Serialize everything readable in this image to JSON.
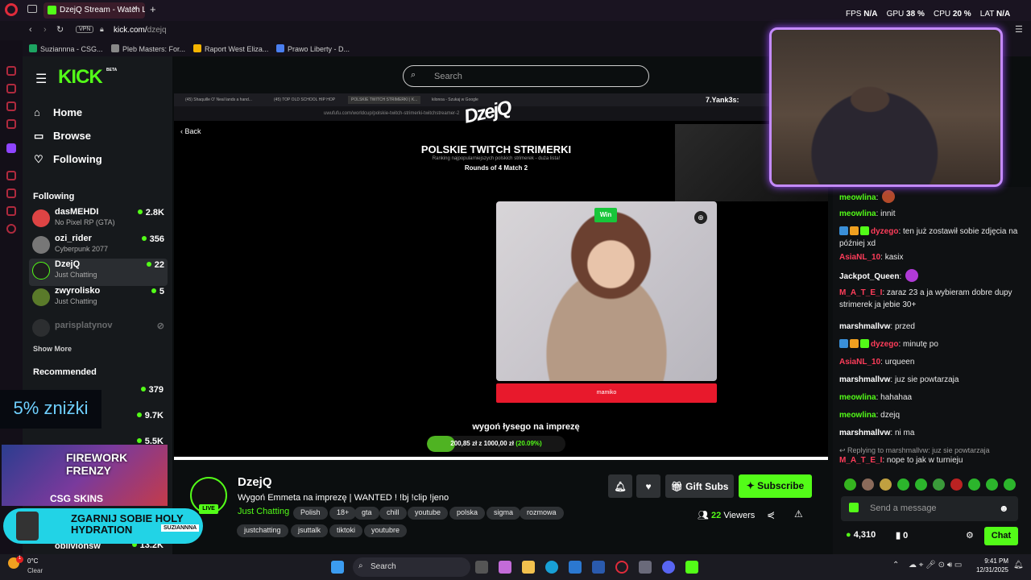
{
  "browser": {
    "tab_title": "DzejQ Stream - Watch Live",
    "url_prefix": "kick.com/",
    "url_path": "dzejq",
    "vpn_label": "VPN",
    "bookmarks": [
      "Suziannna - CSG...",
      "Pleb Masters: For...",
      "Raport West Eliza...",
      "Prawo Liberty - D..."
    ]
  },
  "perf": {
    "fps_label": "FPS",
    "fps_value": "N/A",
    "gpu_label": "GPU",
    "gpu_value": "38 %",
    "cpu_label": "CPU",
    "cpu_value": "20 %",
    "lat_label": "LAT",
    "lat_value": "N/A"
  },
  "kick": {
    "logo": "KICK",
    "beta": "BETA",
    "search_placeholder": "Search",
    "nav": [
      {
        "label": "Home",
        "icon": "home-icon"
      },
      {
        "label": "Browse",
        "icon": "browse-icon"
      },
      {
        "label": "Following",
        "icon": "heart-icon"
      }
    ],
    "following_heading": "Following",
    "following": [
      {
        "name": "dasMEHDI",
        "game": "No Pixel RP (GTA)",
        "viewers": "2.8K",
        "color": "#d44"
      },
      {
        "name": "ozi_rider",
        "game": "Cyberpunk 2077",
        "viewers": "356",
        "color": "#777"
      },
      {
        "name": "DzejQ",
        "game": "Just Chatting",
        "viewers": "22",
        "color": "#2a2a2a"
      },
      {
        "name": "zwyrolisko",
        "game": "Just Chatting",
        "viewers": "5",
        "color": "#5a7a2a"
      },
      {
        "name": "parisplatynov",
        "game": "",
        "viewers": "",
        "color": "#444"
      }
    ],
    "show_more": "Show More",
    "recommended_heading": "Recommended",
    "recommended": [
      {
        "name": "",
        "viewers": "379"
      },
      {
        "name": "",
        "viewers": "9.7K"
      },
      {
        "name": "",
        "viewers": "5.5K"
      },
      {
        "name": "oblivionsw",
        "viewers": "13.2K"
      }
    ]
  },
  "video": {
    "tabs": [
      "(45) Shaquille O' Neal lands a hand...",
      "(45) TOP OLD SCHOOL HIP HOP",
      "POLSKIE TWITCH STRIMERKI | K...",
      "kilonoa - Szukaj w Google"
    ],
    "address": "uwufufu.com/worldcup/polskie-twitch-strimerki-twitchstreamer-2",
    "logo": "DzejQ",
    "back": "Back",
    "title": "POLSKIE TWITCH STRIMERKI",
    "subtitle": "Ranking najpopularniejszych polskich strimerek - duża lista!",
    "round": "Rounds of 4 Match 2",
    "win": "Win",
    "choice_label": "mamiko",
    "goal_text": "wygoń łysego na imprezę",
    "goal_progress": "200,85 zł z 1000,00 zł",
    "goal_percent_text": "(20.09%)",
    "goal_fraction": 0.2009,
    "overlay_user": "7.Yank3s:"
  },
  "stream": {
    "name": "DzejQ",
    "live": "LIVE",
    "title": "Wygoń Emmeta na imprezę | WANTED ! !bj !clip !jeno",
    "category": "Just Chatting",
    "tags": [
      "Polish",
      "18+",
      "gta",
      "chill",
      "youtube",
      "polska",
      "sigma",
      "rozmowa",
      "justchatting",
      "jsuttalk",
      "tiktoki",
      "youtubre"
    ],
    "gift_subs": "Gift Subs",
    "subscribe": "Subscribe",
    "viewers": "22",
    "viewers_label": "Viewers"
  },
  "chat": {
    "messages": [
      {
        "user": "meowlina",
        "text": "",
        "ucolor": "u-green",
        "emote": "#b34a2a"
      },
      {
        "user": "meowlina",
        "text": "innit",
        "ucolor": "u-green"
      },
      {
        "user": "dyzego",
        "text": "ten już zostawił sobie zdjęcia na później xd",
        "ucolor": "u-pink",
        "badges": true
      },
      {
        "user": "AsiaNL_10",
        "text": "kasix",
        "ucolor": "u-pink"
      },
      {
        "user": "Jackpot_Queen",
        "text": "",
        "ucolor": "u-white",
        "emote": "#b03ad6"
      },
      {
        "user": "M_A_T_E_I",
        "text": "zaraz 23 a ja wybieram dobre dupy strimerek ja jebie 30+",
        "ucolor": "u-pink"
      },
      {
        "user": "marshmallvw",
        "text": "przed",
        "ucolor": "u-white"
      },
      {
        "user": "dyzego",
        "text": "minutę po",
        "ucolor": "u-pink",
        "badges": true
      },
      {
        "user": "AsiaNL_10",
        "text": "urqueen",
        "ucolor": "u-pink"
      },
      {
        "user": "marshmallvw",
        "text": "juz sie powtarzaja",
        "ucolor": "u-white"
      },
      {
        "user": "meowlina",
        "text": "hahahaa",
        "ucolor": "u-green"
      },
      {
        "user": "meowlina",
        "text": "dzejq",
        "ucolor": "u-green"
      },
      {
        "user": "marshmallvw",
        "text": "ni ma",
        "ucolor": "u-white"
      }
    ],
    "reply_hint": "Replying to marshmallvw: juz sie powtarzaja",
    "reply_user": "M_A_T_E_I",
    "reply_text": "nope to jak w turnieju",
    "input_placeholder": "Send a message",
    "points": "4,310",
    "counter": "0",
    "chat_button": "Chat"
  },
  "ads": {
    "discount": "5% zniżki",
    "firework_title": "FIREWORK FRENZY",
    "csgo_skins": "CSG SKINS",
    "hydration": "ZGARNIJ SOBIE HOLY HYDRATION",
    "hydration_brand": "SUZIANNNA"
  },
  "taskbar": {
    "weather_temp": "0°C",
    "weather_desc": "Clear",
    "notif_count": "1",
    "search": "Search",
    "time": "9:41 PM",
    "date": "12/31/2025"
  },
  "colors": {
    "accent": "#53fc18",
    "danger": "#e8192c"
  }
}
